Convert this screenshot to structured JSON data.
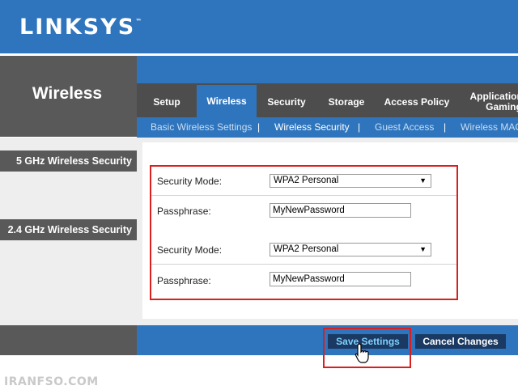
{
  "brand": {
    "logo_text": "LINKSYS",
    "trademark": "™"
  },
  "section": {
    "title": "Wireless"
  },
  "tabs": [
    {
      "label": "Setup",
      "active": false
    },
    {
      "label": "Wireless",
      "active": true
    },
    {
      "label": "Security",
      "active": false
    },
    {
      "label": "Storage",
      "active": false
    },
    {
      "label": "Access Policy",
      "active": false
    },
    {
      "label": "Applications & Gaming",
      "active": false
    }
  ],
  "subnav": {
    "items": [
      {
        "label": "Basic Wireless Settings",
        "active": false
      },
      {
        "label": "Wireless Security",
        "active": true
      },
      {
        "label": "Guest Access",
        "active": false
      },
      {
        "label": "Wireless MAC",
        "active": false
      }
    ],
    "separator": "|"
  },
  "sidebar": {
    "ghz5_label": "5 GHz Wireless Security",
    "ghz24_label": "2.4 GHz Wireless Security"
  },
  "form_5ghz": {
    "security_mode_label": "Security Mode:",
    "security_mode_value": "WPA2 Personal",
    "passphrase_label": "Passphrase:",
    "passphrase_value": "MyNewPassword"
  },
  "form_24ghz": {
    "security_mode_label": "Security Mode:",
    "security_mode_value": "WPA2 Personal",
    "passphrase_label": "Passphrase:",
    "passphrase_value": "MyNewPassword"
  },
  "footer": {
    "save_label": "Save Settings",
    "cancel_label": "Cancel Changes"
  },
  "watermark": "IRANFSO.COM",
  "colors": {
    "brand_blue": "#2f75bd",
    "dark_gray": "#595959",
    "highlight_red": "#d9201f",
    "button_navy": "#1a3a63"
  }
}
